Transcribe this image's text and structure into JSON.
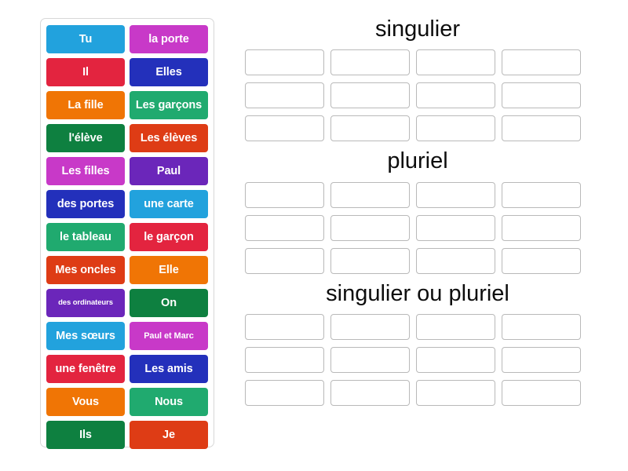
{
  "activity": {
    "type": "group-sort",
    "tray_label": "word tiles"
  },
  "tiles": [
    {
      "label": "Tu",
      "color": "#22a2dd",
      "size": "normal"
    },
    {
      "label": "la porte",
      "color": "#c839c8",
      "size": "normal"
    },
    {
      "label": "Il",
      "color": "#e3243f",
      "size": "normal"
    },
    {
      "label": "Elles",
      "color": "#2330bb",
      "size": "normal"
    },
    {
      "label": "La fille",
      "color": "#f07505",
      "size": "normal"
    },
    {
      "label": "Les garçons",
      "color": "#20aa6f",
      "size": "normal"
    },
    {
      "label": "l'élève",
      "color": "#0e8040",
      "size": "normal"
    },
    {
      "label": "Les élèves",
      "color": "#de3c15",
      "size": "normal"
    },
    {
      "label": "Les filles",
      "color": "#c839c8",
      "size": "normal"
    },
    {
      "label": "Paul",
      "color": "#6b26ba",
      "size": "normal"
    },
    {
      "label": "des portes",
      "color": "#2330bb",
      "size": "normal"
    },
    {
      "label": "une carte",
      "color": "#22a2dd",
      "size": "normal"
    },
    {
      "label": "le tableau",
      "color": "#20aa6f",
      "size": "normal"
    },
    {
      "label": "le garçon",
      "color": "#e3243f",
      "size": "normal"
    },
    {
      "label": "Mes oncles",
      "color": "#de3c15",
      "size": "normal"
    },
    {
      "label": "Elle",
      "color": "#f07505",
      "size": "normal"
    },
    {
      "label": "des ordinateurs",
      "color": "#6b26ba",
      "size": "xs"
    },
    {
      "label": "On",
      "color": "#0e8040",
      "size": "normal"
    },
    {
      "label": "Mes sœurs",
      "color": "#22a2dd",
      "size": "normal"
    },
    {
      "label": "Paul et Marc",
      "color": "#c839c8",
      "size": "sm"
    },
    {
      "label": "une fenêtre",
      "color": "#e3243f",
      "size": "normal"
    },
    {
      "label": "Les amis",
      "color": "#2330bb",
      "size": "normal"
    },
    {
      "label": "Vous",
      "color": "#f07505",
      "size": "normal"
    },
    {
      "label": "Nous",
      "color": "#20aa6f",
      "size": "normal"
    },
    {
      "label": "Ils",
      "color": "#0e8040",
      "size": "normal"
    },
    {
      "label": "Je",
      "color": "#de3c15",
      "size": "normal"
    }
  ],
  "groups": [
    {
      "title": "singulier",
      "slot_count": 12,
      "filled": []
    },
    {
      "title": "pluriel",
      "slot_count": 12,
      "filled": []
    },
    {
      "title": "singulier ou pluriel",
      "slot_count": 12,
      "filled": []
    }
  ],
  "colors": {
    "tray_border": "#d8d8d8",
    "slot_border": "#b9b9b9",
    "background": "#ffffff",
    "title_text": "#0d0d0d",
    "tile_text": "#ffffff"
  }
}
